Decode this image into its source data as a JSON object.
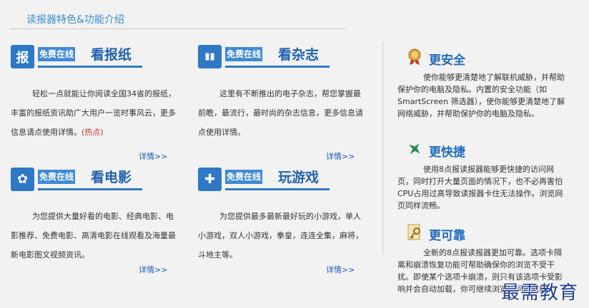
{
  "section": {
    "title": "读报器特色&功能介绍"
  },
  "features": [
    {
      "icon_char": "报",
      "badge": "免费在线",
      "name": "看报纸",
      "desc": "轻松一点就能让你阅读全国34省的报纸，丰富的报纸资讯助广大用户一览时事风云，更多信息请点使用详情。",
      "hot": "(热点)",
      "more": "详情>>"
    },
    {
      "icon_char": "▮▮",
      "badge": "免费在线",
      "name": "看杂志",
      "desc": "这里有不断推出的电子杂志，帮您掌握最前瞻，最流行，最时尚的杂志信息，更多信息请点使用详情。",
      "more": "详情>>"
    },
    {
      "icon_char": "✿",
      "badge": "免费在线",
      "name": "看电影",
      "desc": "为您提供大量好看的电影、经典电影、电影推荐、免费电影、高清电影在线观看及海量最新电影图文视频资讯。",
      "more": "详情>>"
    },
    {
      "icon_char": "✚",
      "badge": "免费在线",
      "name": "玩游戏",
      "desc": "为您提供最多最新最好玩的小游戏，单人小游戏，双人小游戏，拳皇，连连全集，麻将，斗地主等。",
      "more": "详情>>"
    }
  ],
  "sidebar": [
    {
      "icon": "medal-icon",
      "title": "更安全",
      "text": "使你能够更清楚地了解联机威胁，并帮助保护你的电脑及隐私。内置的安全功能（如 SmartScreen 筛选器），使你能够更清楚地了解网络威胁，并帮助保护你的电脑及隐私。"
    },
    {
      "icon": "airplane-icon",
      "title": "更快捷",
      "text": "使用8点报读报器能够更快捷的访问网页，同时打开大量页面的情况下，也不必再害怕CPU占用过高导致读报器卡住无法操作。浏览网页同样流畅。"
    },
    {
      "icon": "key-icon",
      "title": "更可靠",
      "text": "全新的8点报读报器更加可靠。选项卡隔离和崩溃恢复功能可帮助确保你的浏览不受干扰。即使某个选项卡崩溃，则只有该选项卡受影响并会自动加载，你可继续浏览访问的网站。"
    }
  ],
  "watermark": "最需教育",
  "colors": {
    "accent": "#2e78c5",
    "title": "#1e62b0",
    "hot": "#c0392b",
    "background": "#f2f2f2"
  }
}
